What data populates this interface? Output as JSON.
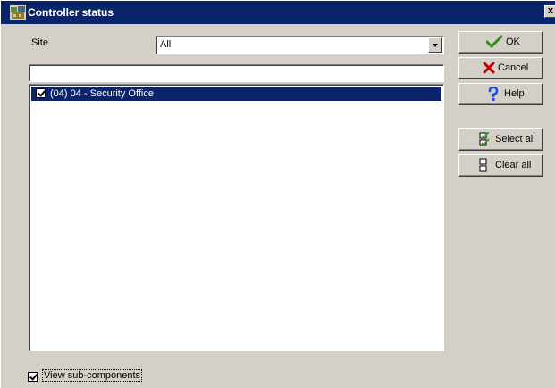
{
  "window": {
    "title": "Controller status",
    "close_label": "x"
  },
  "site": {
    "label": "Site",
    "selected": "All"
  },
  "filter": {
    "value": ""
  },
  "list": {
    "items": [
      {
        "label": "(04) 04 - Security Office",
        "checked": true,
        "selected": true
      }
    ]
  },
  "buttons": {
    "ok": "OK",
    "cancel": "Cancel",
    "help": "Help",
    "select_all": "Select all",
    "clear_all": "Clear all"
  },
  "options": {
    "view_sub_components": {
      "label": "View sub-components",
      "checked": true
    }
  },
  "colors": {
    "titlebar": "#0a246a",
    "selection": "#0a246a",
    "face": "#d4d0c8",
    "ok_check": "#2e8b1e",
    "cancel_x": "#c00000",
    "help_mark": "#1e50d8"
  },
  "icons": {
    "title": "controller-app-icon",
    "ok": "checkmark-icon",
    "cancel": "red-x-icon",
    "help": "question-mark-icon",
    "select_all": "select-all-icon",
    "clear_all": "clear-all-icon"
  }
}
